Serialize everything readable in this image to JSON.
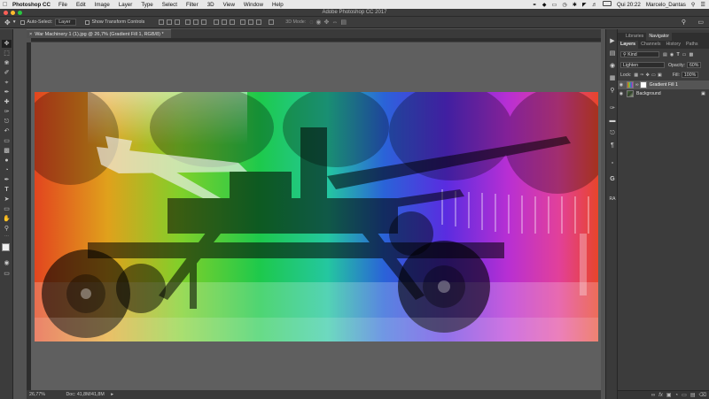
{
  "menubar": {
    "app_name": "Photoshop CC",
    "items": [
      "File",
      "Edit",
      "Image",
      "Layer",
      "Type",
      "Select",
      "Filter",
      "3D",
      "View",
      "Window",
      "Help"
    ],
    "clock": "Qui 20:22",
    "user": "Marcelo_Dantas"
  },
  "window": {
    "title": "Adobe Photoshop CC 2017"
  },
  "options": {
    "auto_select_label": "Auto-Select:",
    "auto_select_target": "Layer",
    "show_transform_label": "Show Transform Controls",
    "mode_3d_label": "3D Mode:"
  },
  "document": {
    "tab_title": "War Machinery 1 (1).jpg @ 26,7% (Gradient Fill 1, RGB/8) *",
    "zoom": "26,77%",
    "doc_size": "Doc: 41,8M/41,8M"
  },
  "panels": {
    "top_tabs": [
      "Libraries",
      "Navigator"
    ],
    "layer_tabs": [
      "Layers",
      "Channels",
      "History",
      "Paths"
    ],
    "filter_kind": "Kind",
    "blend_mode": "Lighten",
    "opacity_label": "Opacity:",
    "opacity_value": "60%",
    "lock_label": "Lock:",
    "fill_label": "Fill:",
    "fill_value": "100%",
    "layers": [
      {
        "name": "Gradient Fill 1"
      },
      {
        "name": "Background"
      }
    ]
  },
  "colors": {
    "accent": "#2d6bd6",
    "canvas_bg": "#5f5f5f",
    "panel_bg": "#3c3c3c"
  }
}
